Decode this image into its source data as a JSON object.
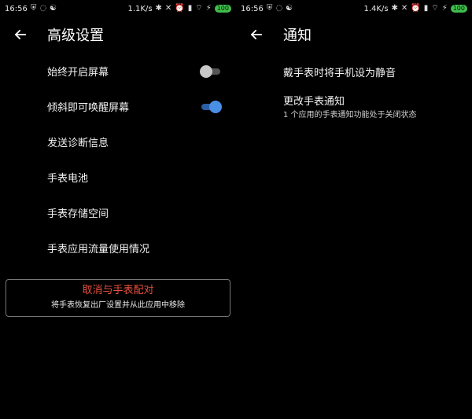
{
  "left": {
    "status": {
      "time": "16:56",
      "speed": "1.1K/s",
      "battery": "100"
    },
    "title": "高级设置",
    "settings": [
      {
        "label": "始终开启屏幕",
        "toggle": "off"
      },
      {
        "label": "倾斜即可唤醒屏幕",
        "toggle": "on"
      },
      {
        "label": "发送诊断信息"
      },
      {
        "label": "手表电池"
      },
      {
        "label": "手表存储空间"
      },
      {
        "label": "手表应用流量使用情况"
      }
    ],
    "unpair": {
      "label": "取消与手表配对",
      "desc": "将手表恢复出厂设置并从此应用中移除"
    }
  },
  "right": {
    "status": {
      "time": "16:56",
      "speed": "1.4K/s",
      "battery": "100"
    },
    "title": "通知",
    "items": [
      {
        "label": "戴手表时将手机设为静音",
        "sub": ""
      },
      {
        "label": "更改手表通知",
        "sub": "1 个应用的手表通知功能处于关闭状态"
      }
    ]
  },
  "icons": {
    "back": "arrow-left-icon",
    "bluetooth": "bluetooth-icon",
    "alarm": "alarm-icon",
    "signal": "signal-icon",
    "wifi": "wifi-icon"
  },
  "colors": {
    "background": "#000000",
    "switchOn": "#4a8fe6",
    "switchOff": "#c8c8c8",
    "danger": "#e8503e",
    "battery": "#3fbf4c"
  }
}
